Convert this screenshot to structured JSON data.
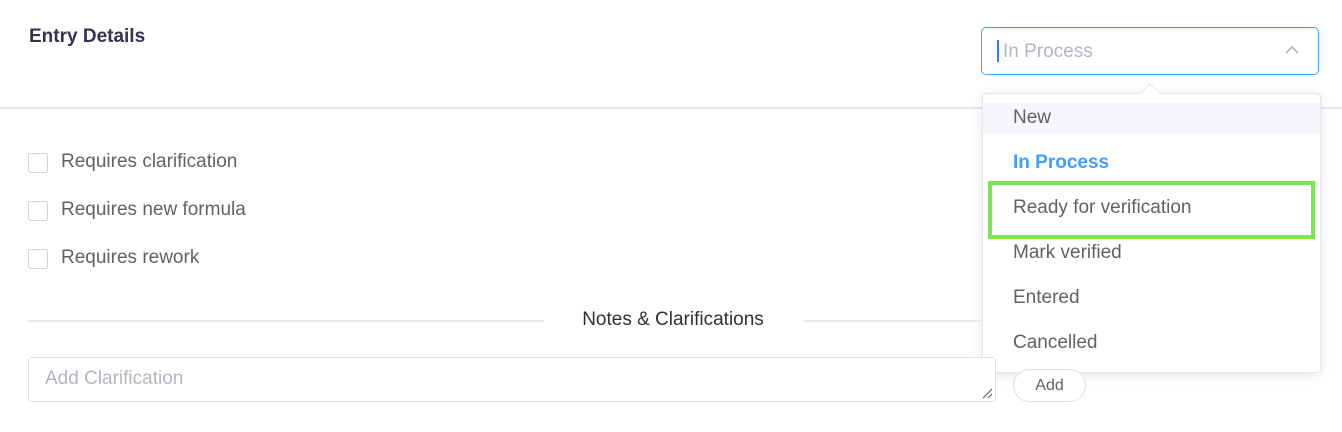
{
  "header": {
    "title": "Entry Details"
  },
  "status_select": {
    "value": "In Process",
    "options": [
      "New",
      "In Process",
      "Ready for verification",
      "Mark verified",
      "Entered",
      "Cancelled"
    ],
    "selected": "In Process",
    "hovered": "New",
    "highlighted": "Ready for verification"
  },
  "checkboxes": [
    {
      "label": "Requires clarification",
      "checked": false
    },
    {
      "label": "Requires new formula",
      "checked": false
    },
    {
      "label": "Requires rework",
      "checked": false
    }
  ],
  "notes": {
    "title": "Notes & Clarifications",
    "input_placeholder": "Add Clarification",
    "add_label": "Add"
  },
  "colors": {
    "accent": "#409eff",
    "highlight": "#7be653",
    "title": "#303450"
  }
}
